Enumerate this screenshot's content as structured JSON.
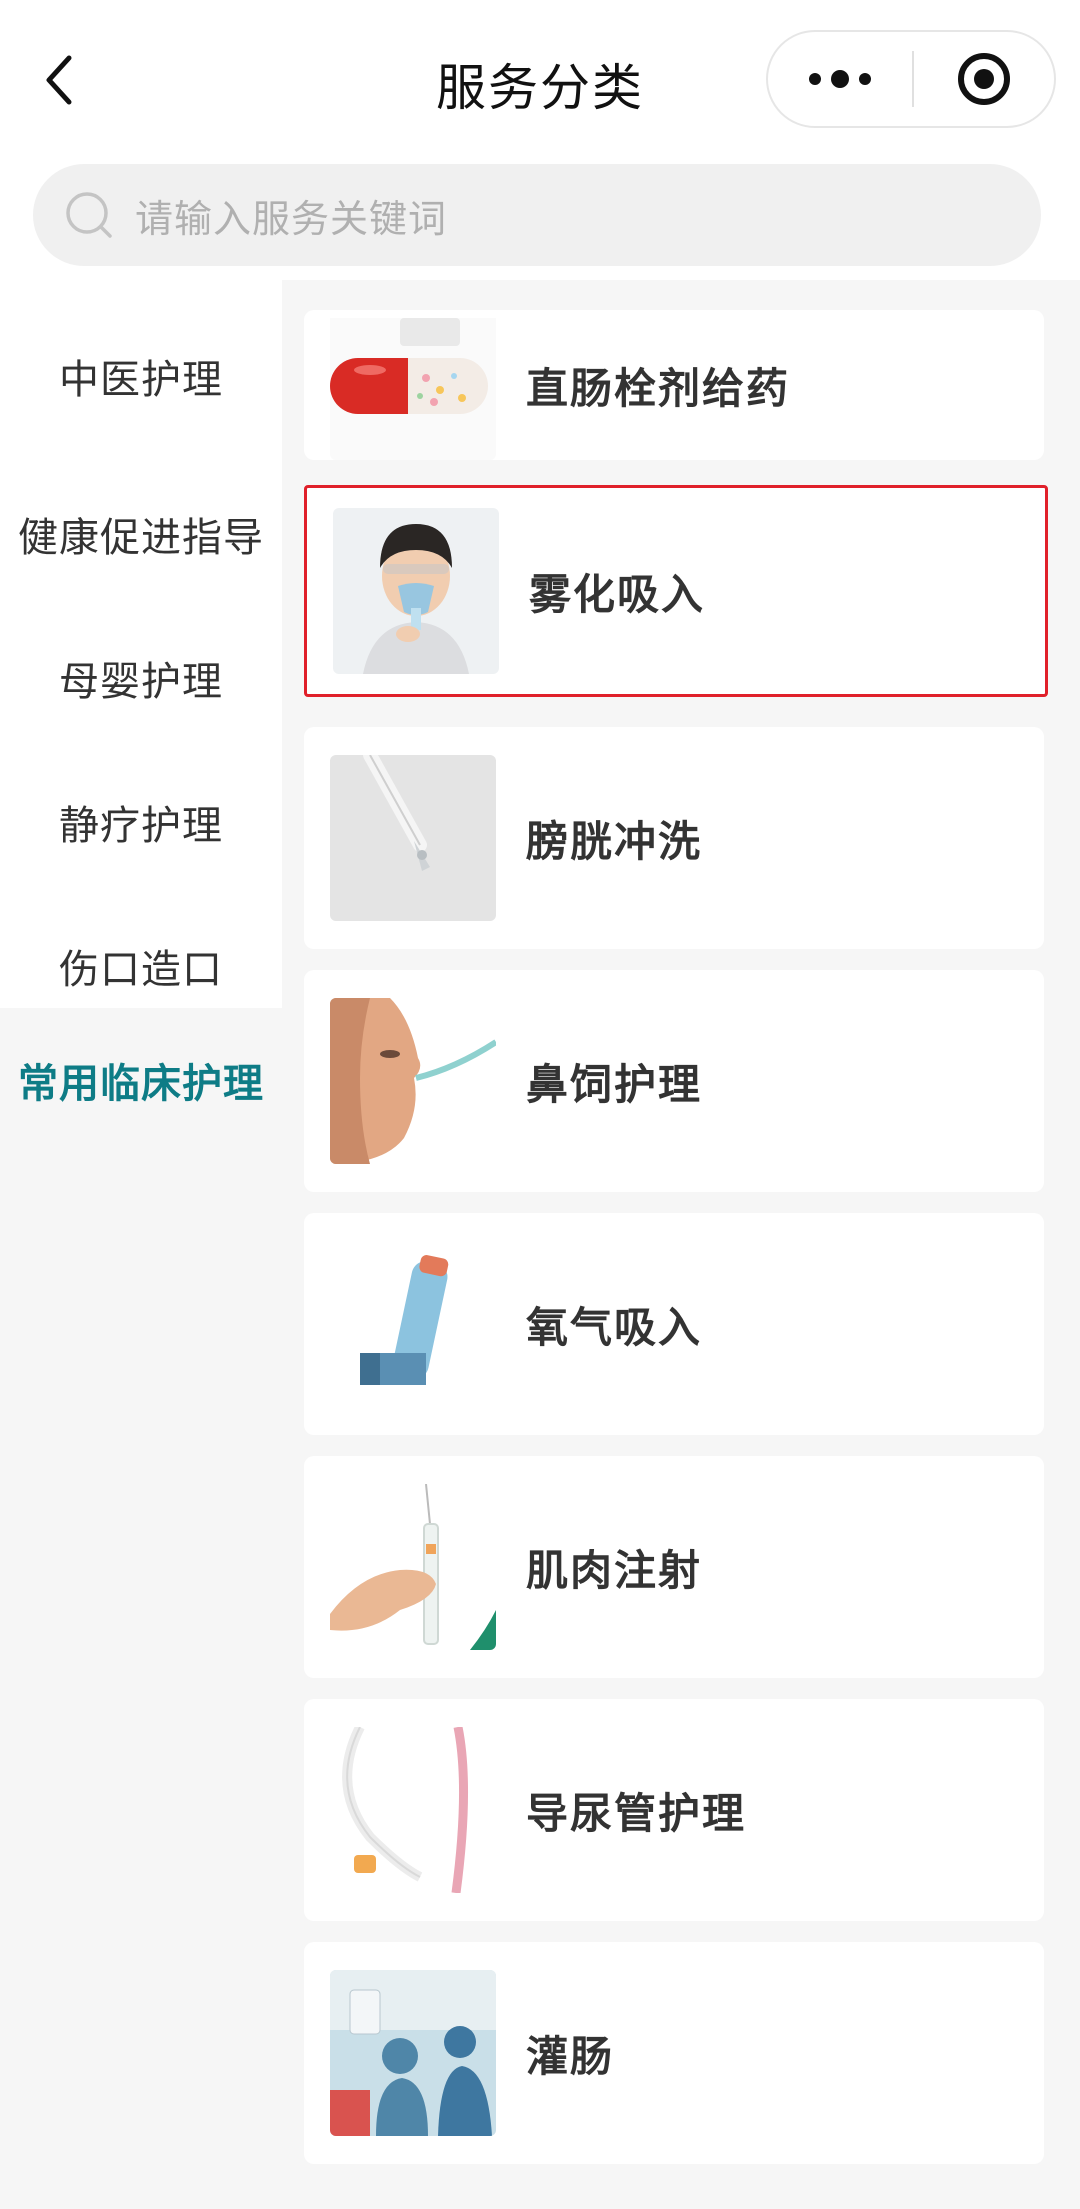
{
  "header": {
    "title": "服务分类",
    "back_icon": "chevron-left-icon",
    "more_icon": "more-dots-icon",
    "close_icon": "target-circle-icon"
  },
  "search": {
    "placeholder": "请输入服务关键词",
    "icon": "search-icon"
  },
  "sidebar": {
    "items": [
      {
        "label": "中医护理",
        "active": false
      },
      {
        "label": "健康促进指导",
        "active": false
      },
      {
        "label": "母婴护理",
        "active": false
      },
      {
        "label": "静疗护理",
        "active": false
      },
      {
        "label": "伤口造口",
        "active": false
      },
      {
        "label": "常用临床护理",
        "active": true
      }
    ],
    "active_color": "#0e7c86"
  },
  "services": [
    {
      "title": "直肠栓剂给药",
      "image": "capsule-pill-photo"
    },
    {
      "title": "雾化吸入",
      "image": "child-nebulizer-mask-photo",
      "highlighted": true
    },
    {
      "title": "膀胱冲洗",
      "image": "dropper-tube-photo"
    },
    {
      "title": "鼻饲护理",
      "image": "nasal-tube-face-photo"
    },
    {
      "title": "氧气吸入",
      "image": "inhaler-photo"
    },
    {
      "title": "肌肉注射",
      "image": "syringe-hand-photo"
    },
    {
      "title": "导尿管护理",
      "image": "catheter-photo"
    },
    {
      "title": "灌肠",
      "image": "operating-room-photo"
    }
  ],
  "colors": {
    "highlight_border": "#e0202a",
    "background": "#f6f6f6"
  }
}
